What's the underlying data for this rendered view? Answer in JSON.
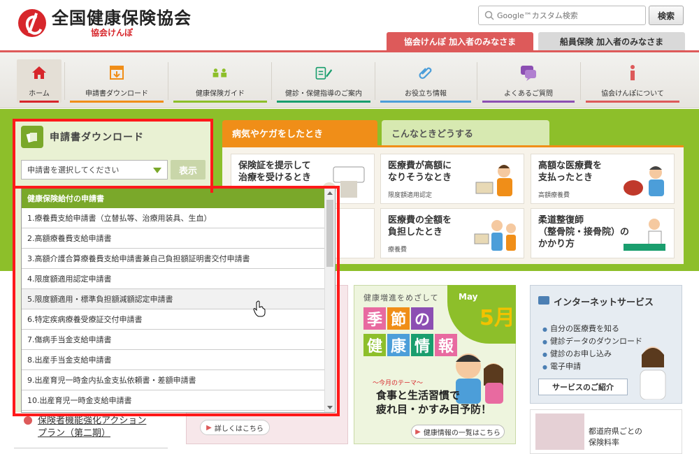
{
  "header": {
    "logo_title": "全国健康保険協会",
    "logo_sub": "協会けんぽ",
    "search_placeholder": "Google™カスタム検索",
    "search_button": "検索",
    "tab_members": "協会けんぽ 加入者のみなさま",
    "tab_seamen": "船員保険 加入者のみなさま"
  },
  "nav": {
    "items": [
      {
        "label": "ホーム",
        "icon": "home-icon",
        "color": "#d7262b"
      },
      {
        "label": "申請書ダウンロード",
        "icon": "download-form-icon",
        "color": "#f08e18"
      },
      {
        "label": "健康保険ガイド",
        "icon": "guide-icon",
        "color": "#8dbf2a"
      },
      {
        "label": "健診・保健指導のご案内",
        "icon": "checkup-icon",
        "color": "#1a9e6e"
      },
      {
        "label": "お役立ち情報",
        "icon": "paperclip-icon",
        "color": "#4c9ed9"
      },
      {
        "label": "よくあるご質問",
        "icon": "faq-icon",
        "color": "#8c4fb3"
      },
      {
        "label": "協会けんぽについて",
        "icon": "info-icon",
        "color": "#dd5a5a"
      }
    ]
  },
  "download": {
    "title": "申請書ダウンロード",
    "select_value": "申請書を選択してください",
    "show_button": "表示",
    "group_header": "健康保険給付の申請書",
    "options": [
      "1.療養費支給申請書（立替払等、治療用装具、生血）",
      "2.高額療養費支給申請書",
      "3.高額介護合算療養費支給申請書兼自己負担額証明書交付申請書",
      "4.限度額適用認定申請書",
      "5.限度額適用・標準負担額減額認定申請書",
      "6.特定疾病療養受療証交付申請書",
      "7.傷病手当金支給申請書",
      "8.出産手当金支給申請書",
      "9.出産育児一時金内払金支払依頼書・差額申請書",
      "10.出産育児一時金支給申請書"
    ],
    "highlighted_index": 4
  },
  "situations": {
    "tab_active": "病気やケガをしたとき",
    "tab_other": "こんなときどうする",
    "cards": [
      {
        "title": "保険証を提示して\n治療を受けるとき",
        "sub": ""
      },
      {
        "title": "医療費が高額に\nなりそうなとき",
        "sub": "限度額適用認定"
      },
      {
        "title": "高額な医療費を\n支払ったとき",
        "sub": "高額療養費"
      },
      {
        "title": "",
        "sub": ""
      },
      {
        "title": "医療費の全額を\n負担したとき",
        "sub": "療養費"
      },
      {
        "title": "柔道整復師\n（整骨院・接骨院）の\nかかり方",
        "sub": ""
      }
    ]
  },
  "news": {
    "link_text": "保険者機能強化アクション\nプラン（第二期）"
  },
  "pink_banner": {
    "button": "詳しくはこちら"
  },
  "health": {
    "caption": "健康増進をめざして",
    "may": "May",
    "month": "5月",
    "tiles": [
      "季",
      "節",
      "の",
      "健",
      "康",
      "情",
      "報"
    ],
    "theme": "〜今月のテーマ〜",
    "main": "食事と生活習慣で\n疲れ目・かすみ目予防！",
    "button": "健康情報の一覧はこちら"
  },
  "internet": {
    "title": "インターネットサービス",
    "items": [
      "自分の医療費を知る",
      "健診データのダウンロード",
      "健診のお申し込み",
      "電子申請"
    ],
    "button": "サービスのご紹介"
  },
  "prefecture": {
    "text": "都道府県ごとの\n保険料率"
  }
}
